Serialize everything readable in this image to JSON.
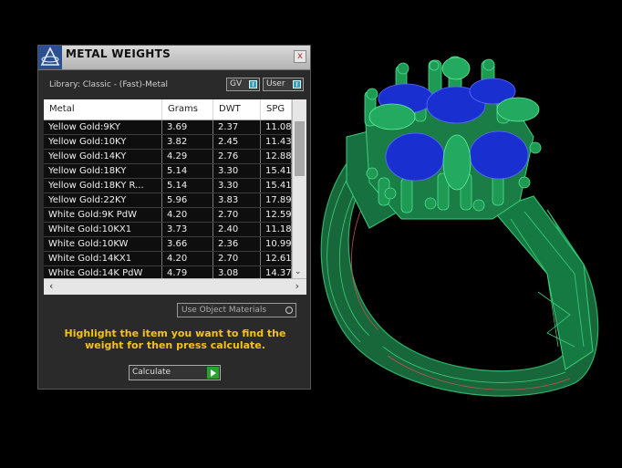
{
  "panel": {
    "title": "METAL WEIGHTS",
    "close_label": "x",
    "library_label": "Library: Classic - (Fast)-Metal",
    "toggles": {
      "gv": "GV",
      "user": "User"
    },
    "table": {
      "columns": [
        "Metal",
        "Grams",
        "DWT",
        "SPG"
      ],
      "rows": [
        [
          "Yellow Gold:9KY",
          "3.69",
          "2.37",
          "11.08"
        ],
        [
          "Yellow Gold:10KY",
          "3.82",
          "2.45",
          "11.43"
        ],
        [
          "Yellow Gold:14KY",
          "4.29",
          "2.76",
          "12.88"
        ],
        [
          "Yellow Gold:18KY",
          "5.14",
          "3.30",
          "15.41"
        ],
        [
          "Yellow Gold:18KY R...",
          "5.14",
          "3.30",
          "15.41"
        ],
        [
          "Yellow Gold:22KY",
          "5.96",
          "3.83",
          "17.89"
        ],
        [
          "White Gold:9K PdW",
          "4.20",
          "2.70",
          "12.59"
        ],
        [
          "White Gold:10KX1",
          "3.73",
          "2.40",
          "11.18"
        ],
        [
          "White Gold:10KW",
          "3.66",
          "2.36",
          "10.99"
        ],
        [
          "White Gold:14KX1",
          "4.20",
          "2.70",
          "12.61"
        ],
        [
          "White Gold:14K PdW",
          "4.79",
          "3.08",
          "14.37"
        ]
      ]
    },
    "use_object_materials": "Use Object Materials",
    "instructions": "Highlight the item you want to find the weight for then press calculate.",
    "calculate_label": "Calculate"
  },
  "colors": {
    "ring_green": "#1f8a4c",
    "gem_blue": "#1a2fd0",
    "instruction_yellow": "#f2c318"
  }
}
